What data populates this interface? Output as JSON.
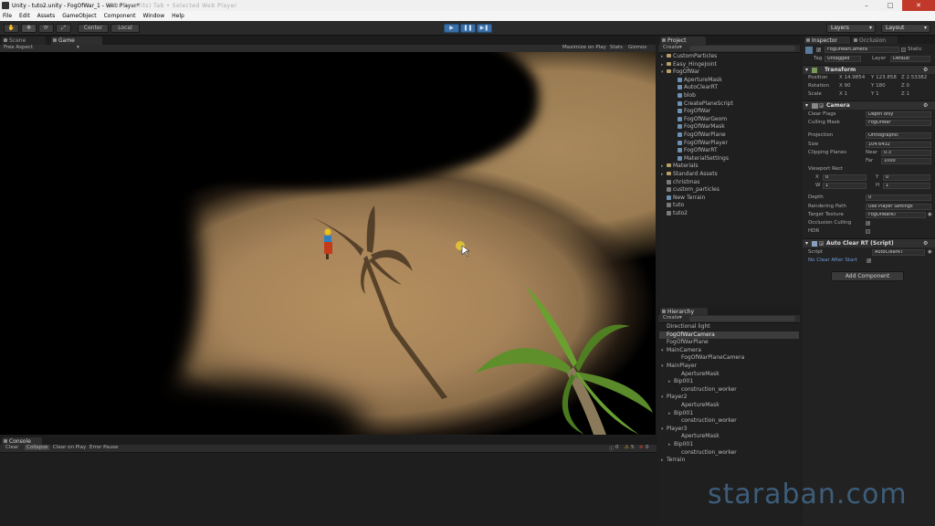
{
  "window": {
    "title": "Unity - tuto2.unity - FogOfWar_1 - Web Player*",
    "ghost_text": "(SiteBenefits) Tab • Selected Web Player"
  },
  "menu": [
    "File",
    "Edit",
    "Assets",
    "GameObject",
    "Component",
    "Window",
    "Help"
  ],
  "toolbar": {
    "pivot": "Center",
    "space": "Local",
    "layers": "Layers",
    "layout": "Layout"
  },
  "scene_tabs": {
    "scene": "Scene",
    "game": "Game"
  },
  "game_bar": {
    "aspect": "Free Aspect",
    "maximize": "Maximize on Play",
    "stats": "Stats",
    "gizmos": "Gizmos"
  },
  "project": {
    "tab": "Project",
    "create": "Create",
    "items": [
      {
        "label": "CustomParticles",
        "kind": "folder",
        "indent": 0,
        "fold": "▸"
      },
      {
        "label": "Easy_HingeJoint",
        "kind": "folder",
        "indent": 0,
        "fold": "▸"
      },
      {
        "label": "FogOfWar",
        "kind": "folder",
        "indent": 0,
        "fold": "▾"
      },
      {
        "label": "ApertureMask",
        "kind": "asset",
        "indent": 1,
        "fold": ""
      },
      {
        "label": "AutoClearRT",
        "kind": "asset",
        "indent": 1,
        "fold": ""
      },
      {
        "label": "blob",
        "kind": "asset",
        "indent": 1,
        "fold": ""
      },
      {
        "label": "CreatePlaneScript",
        "kind": "asset",
        "indent": 1,
        "fold": ""
      },
      {
        "label": "FogOfWar",
        "kind": "asset",
        "indent": 1,
        "fold": ""
      },
      {
        "label": "FogOfWarGeom",
        "kind": "asset",
        "indent": 1,
        "fold": ""
      },
      {
        "label": "FogOfWarMask",
        "kind": "asset",
        "indent": 1,
        "fold": ""
      },
      {
        "label": "FogOfWarPlane",
        "kind": "asset",
        "indent": 1,
        "fold": ""
      },
      {
        "label": "FogOfWarPlayer",
        "kind": "asset",
        "indent": 1,
        "fold": ""
      },
      {
        "label": "FogOfWarRT",
        "kind": "asset",
        "indent": 1,
        "fold": ""
      },
      {
        "label": "MaterialSettings",
        "kind": "asset",
        "indent": 1,
        "fold": ""
      },
      {
        "label": "Materials",
        "kind": "folder",
        "indent": 0,
        "fold": "▸"
      },
      {
        "label": "Standard Assets",
        "kind": "folder",
        "indent": 0,
        "fold": "▸"
      },
      {
        "label": "christmas",
        "kind": "scene",
        "indent": 0,
        "fold": ""
      },
      {
        "label": "custom_particles",
        "kind": "scene",
        "indent": 0,
        "fold": ""
      },
      {
        "label": "New Terrain",
        "kind": "asset",
        "indent": 0,
        "fold": ""
      },
      {
        "label": "tuto",
        "kind": "scene",
        "indent": 0,
        "fold": ""
      },
      {
        "label": "tuto2",
        "kind": "scene",
        "indent": 0,
        "fold": ""
      }
    ]
  },
  "hierarchy": {
    "tab": "Hierarchy",
    "create": "Create",
    "items": [
      {
        "label": "Directional light",
        "indent": 0,
        "fold": "",
        "selected": false
      },
      {
        "label": "FogOfWarCamera",
        "indent": 0,
        "fold": "",
        "selected": true
      },
      {
        "label": "FogOfWarPlane",
        "indent": 0,
        "fold": "",
        "selected": false
      },
      {
        "label": "MainCamera",
        "indent": 0,
        "fold": "▾",
        "selected": false
      },
      {
        "label": "FogOfWarPlaneCamera",
        "indent": 2,
        "fold": "",
        "selected": false
      },
      {
        "label": "MainPlayer",
        "indent": 0,
        "fold": "▾",
        "selected": false
      },
      {
        "label": "ApertureMask",
        "indent": 2,
        "fold": "",
        "selected": false
      },
      {
        "label": "Bip001",
        "indent": 1,
        "fold": "▸",
        "selected": false
      },
      {
        "label": "construction_worker",
        "indent": 2,
        "fold": "",
        "selected": false
      },
      {
        "label": "Player2",
        "indent": 0,
        "fold": "▾",
        "selected": false
      },
      {
        "label": "ApertureMask",
        "indent": 2,
        "fold": "",
        "selected": false
      },
      {
        "label": "Bip001",
        "indent": 1,
        "fold": "▸",
        "selected": false
      },
      {
        "label": "construction_worker",
        "indent": 2,
        "fold": "",
        "selected": false
      },
      {
        "label": "Player3",
        "indent": 0,
        "fold": "▾",
        "selected": false
      },
      {
        "label": "ApertureMask",
        "indent": 2,
        "fold": "",
        "selected": false
      },
      {
        "label": "Bip001",
        "indent": 1,
        "fold": "▸",
        "selected": false
      },
      {
        "label": "construction_worker",
        "indent": 2,
        "fold": "",
        "selected": false
      },
      {
        "label": "Terrain",
        "indent": 0,
        "fold": "▸",
        "selected": false
      }
    ]
  },
  "inspector": {
    "tab": "Inspector",
    "tab2": "Occlusion",
    "object_name": "FogOfWarCamera",
    "static": "Static",
    "tag_label": "Tag",
    "tag": "Untagged",
    "layer_label": "Layer",
    "layer": "Default",
    "transform": {
      "title": "Transform",
      "position_label": "Position",
      "px": "X 14.9854",
      "py": "Y 123.858",
      "pz": "Z 2.53382",
      "rotation_label": "Rotation",
      "rx": "X 90",
      "ry": "Y 180",
      "rz": "Z 0",
      "scale_label": "Scale",
      "sx": "X 1",
      "sy": "Y 1",
      "sz": "Z 1"
    },
    "camera": {
      "title": "Camera",
      "clear_flags_label": "Clear Flags",
      "clear_flags": "Depth only",
      "culling_mask_label": "Culling Mask",
      "culling_mask": "FogOfWar",
      "projection_label": "Projection",
      "projection": "Orthographic",
      "size_label": "Size",
      "size": "104.6432",
      "clipping_label": "Clipping Planes",
      "near_label": "Near",
      "near": "0.3",
      "far_label": "Far",
      "far": "1000",
      "viewport_label": "Viewport Rect",
      "vx_label": "X",
      "vx": "0",
      "vy_label": "Y",
      "vy": "0",
      "vw_label": "W",
      "vw": "1",
      "vh_label": "H",
      "vh": "1",
      "depth_label": "Depth",
      "depth": "0",
      "rendering_path_label": "Rendering Path",
      "rendering_path": "Use Player Settings",
      "target_texture_label": "Target Texture",
      "target_texture": "FogOfWarRT",
      "occlusion_label": "Occlusion Culling",
      "hdr_label": "HDR"
    },
    "script_comp": {
      "title": "Auto Clear RT (Script)",
      "script_label": "Script",
      "script": "AutoClearRT",
      "no_clear_label": "No Clear After Start"
    },
    "add_component": "Add Component"
  },
  "console": {
    "tab": "Console",
    "clear": "Clear",
    "collapse": "Collapse",
    "clear_on_play": "Clear on Play",
    "error_pause": "Error Pause",
    "count_info": "0",
    "count_warn": "5",
    "count_err": "0"
  },
  "watermark": "staraban.com",
  "colors": {
    "selection": "#3c3c3c",
    "play_accent": "#3a6ea5",
    "close_button": "#c0392b",
    "watermark": "#3d5d7a"
  }
}
